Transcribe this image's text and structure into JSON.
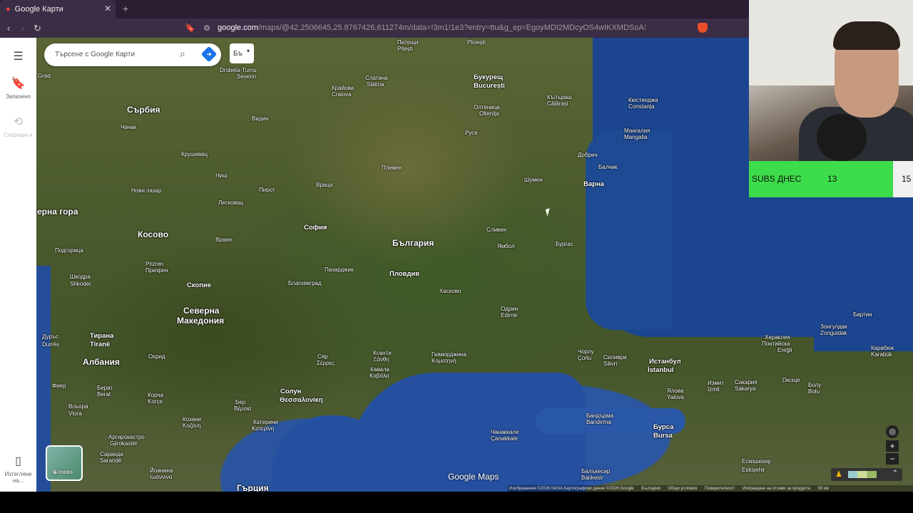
{
  "browser": {
    "tab_title": "Google Карти",
    "url_host": "google.com",
    "url_rest": "/maps/@42.2506645,25.8767426,611274m/data=!3m1!1e3?entry=ttu&g_ep=EgoyMDI2MDcyOS4wIKXMDSoASAFQAw%3D%3D"
  },
  "rail": {
    "saved": "Запазено",
    "recent": "Скорошн и",
    "measure": "Изтегляне на..."
  },
  "search": {
    "placeholder": "Търсене с Google Карти"
  },
  "lang_button": "Бъ",
  "layers_label": "Слоеве",
  "logo": "Google Maps",
  "footer": [
    "Изображения ©2026 NASA,Картографски данни ©2026 Google",
    "България",
    "Общи условия",
    "Поверителност",
    "Изпращане на отзиви за продукта",
    "50 км"
  ],
  "subs": {
    "label": "SUBS ДНЕС",
    "count": "13",
    "next": "15"
  },
  "map_labels": {
    "serbia": "Сърбия",
    "kosovo": "Косово",
    "bulgaria": "България",
    "n_macedonia_1": "Северна",
    "n_macedonia_2": "Македония",
    "albania": "Албания",
    "greece": "Гърция",
    "montenegro": "ерна гора",
    "sofia": "София",
    "plovdiv": "Пловдив",
    "varna": "Варна",
    "burgas": "Бургас",
    "bucharest_1": "Букурещ",
    "bucharest_2": "București",
    "istanbul_1": "Истанбул",
    "istanbul_2": "İstanbul",
    "thessaloniki_1": "Солун",
    "thessaloniki_2": "Θεσσαλονίκη",
    "bursa_1": "Бурса",
    "bursa_2": "Bursa",
    "skopje": "Скопие",
    "tirana_1": "Тирана",
    "tirana_2": "Tiranë",
    "pleven": "Плевен",
    "ruse": "Русе",
    "shumen": "Шумен",
    "sliven": "Сливен",
    "yambol": "Ямбол",
    "haskovo": "Хасково",
    "pazardzhik": "Пазарджик",
    "blagoevgrad": "Благоевград",
    "vratsa": "Враца",
    "pirot": "Пирот",
    "nis": "Ниш",
    "vidin": "Видин",
    "craiova_1": "Крайова",
    "craiova_2": "Craiova",
    "slatina_1": "Слатина",
    "slatina_2": "Slatina",
    "constanta_1": "Кюстенджа",
    "constanta_2": "Constanța",
    "dobrich": "Добрич",
    "balchik": "Балчик",
    "mangalia_1": "Мангалия",
    "mangalia_2": "Mangalia",
    "edirne_1": "Одрин",
    "edirne_2": "Edirne",
    "kavala_1": "Кавала",
    "kavala_2": "Καβάλα",
    "xanthi_1": "Ксанти",
    "xanthi_2": "Ξάνθη",
    "serres_1": "Сяр",
    "serres_2": "Σέρρες",
    "komotini_1": "Гюмюрджина",
    "komotini_2": "Κομοτηνή",
    "corlu_1": "Чорлу",
    "corlu_2": "Çorlu",
    "silivri_1": "Силиври",
    "silivri_2": "Silivri",
    "izmit_1": "Измит",
    "izmit_2": "İzmit",
    "bartin": "Бартин",
    "zonguldak_1": "Зонгулдак",
    "zonguldak_2": "Zonguldak",
    "eregli_1": "Хераклея",
    "eregli_2": "Понтийска",
    "eregli_3": "Ereğli",
    "karabuk_1": "Карабюк",
    "karabuk_2": "Karabük",
    "bolu_1": "Болу",
    "bolu_2": "Bolu",
    "duzce": "Dюзце",
    "sakarya_1": "Сакария",
    "sakarya_2": "Sakarya",
    "yalova_1": "Ялова",
    "yalova_2": "Yalova",
    "bandirma_1": "Бандърма",
    "bandirma_2": "Bandırma",
    "canakkale_1": "Чанаккале",
    "canakkale_2": "Çanakkale",
    "balikesir_1": "Балъкесир",
    "balikesir_2": "Balıkesir",
    "eskisehir_1": "Ескишехир",
    "eskisehir_2": "Eskişehir",
    "durres_1": "Дуръс",
    "durres_2": "Durrës",
    "shkoder_1": "Шкодра",
    "shkoder_2": "Shkoder",
    "podgorica": "Подгорица",
    "prizren_1": "Prizren",
    "prizren_2": "Призрен",
    "ohrid": "Охрид",
    "vlora_1": "Вльора",
    "vlora_2": "Vlora",
    "fier": "Фиер",
    "berat_1": "Берат",
    "berat_2": "Berat",
    "korce_1": "Корча",
    "korce_2": "Korçe",
    "kozani_1": "Козани",
    "kozani_2": "Κοζάνη",
    "veria_1": "Бер",
    "veria_2": "Βέροια",
    "katerini_1": "Катерини",
    "katerini_2": "Κατερίνη",
    "ioannina_1": "Йоанина",
    "ioannina_2": "Ιωάννινα",
    "saranda_1": "Саранда",
    "saranda_2": "Sarandë",
    "gjirokaster_1": "Аргирокастро",
    "gjirokaster_2": "Gjirokastër",
    "krusevac": "Крушевац",
    "novi_pazar": "Нови пазар",
    "leskovac": "Лесковац",
    "vranje": "Враня",
    "cacak": "Чачак",
    "pitesti_1": "Питещи",
    "pitesti_2": "Pitești",
    "ploiesti": "Ploiești",
    "oltenita_1": "Олтеница",
    "oltenita_2": "Oltenița",
    "calarasi_1": "Кълъраш",
    "calarasi_2": "Călărași",
    "turnu_1": "Drobeta-Turnu",
    "turnu_2": "Severin",
    "grad": "Grad"
  }
}
